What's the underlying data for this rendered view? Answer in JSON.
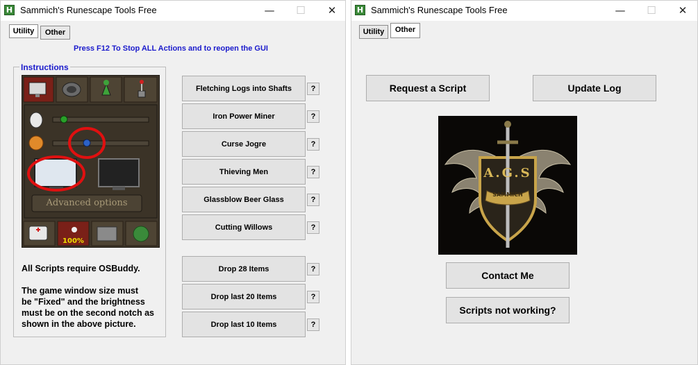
{
  "left_window": {
    "title": "Sammich's Runescape Tools Free",
    "app_icon": "H",
    "controls": {
      "minimize": "—",
      "maximize": "☐",
      "close": "✕"
    },
    "tabs": [
      {
        "label": "Utility",
        "active": true
      },
      {
        "label": "Other",
        "active": false
      }
    ],
    "notice": "Press F12 To Stop ALL Actions and to reopen the GUI",
    "instructions": {
      "title": "Instructions",
      "settings_image": {
        "advanced_label": "Advanced options",
        "run_label": "100%"
      },
      "text_lines": [
        "All Scripts require OSBuddy.",
        "",
        "The game window size must",
        "be \"Fixed\" and the brightness",
        "must be on the second notch as",
        "shown in the above picture."
      ]
    },
    "scripts": [
      "Fletching Logs into Shafts",
      "Iron Power Miner",
      "Curse Jogre",
      "Thieving Men",
      "Glassblow Beer Glass",
      "Cutting Willows",
      "Drop 28 Items",
      "Drop last 20 Items",
      "Drop last 10 Items"
    ],
    "help_label": "?"
  },
  "right_window": {
    "title": "Sammich's Runescape Tools Free",
    "app_icon": "H",
    "controls": {
      "minimize": "—",
      "maximize": "☐",
      "close": "✕"
    },
    "tabs": [
      {
        "label": "Utility",
        "active": false
      },
      {
        "label": "Other",
        "active": true
      }
    ],
    "request_button": "Request a Script",
    "update_button": "Update Log",
    "logo": {
      "text": "A.G.S",
      "banner": "SAMMICH"
    },
    "contact_button": "Contact Me",
    "not_working_button": "Scripts not working?"
  },
  "colors": {
    "accent_blue": "#1a1acc",
    "window_bg": "#f0f0f0",
    "button_bg": "#e3e3e3",
    "highlight_red": "#e01010"
  }
}
